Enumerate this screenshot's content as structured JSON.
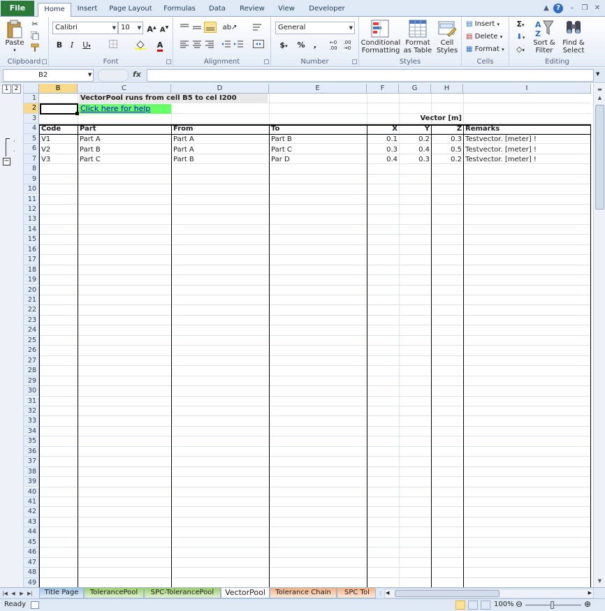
{
  "ribbon": {
    "file_tab": "File",
    "tabs": [
      "Home",
      "Insert",
      "Page Layout",
      "Formulas",
      "Data",
      "Review",
      "View",
      "Developer"
    ],
    "groups": {
      "clipboard": {
        "label": "Clipboard",
        "paste": "Paste"
      },
      "font": {
        "label": "Font",
        "font_name": "Calibri",
        "font_size": "10"
      },
      "alignment": {
        "label": "Alignment"
      },
      "number": {
        "label": "Number",
        "format": "General"
      },
      "styles": {
        "label": "Styles",
        "conditional": "Conditional Formatting",
        "format_table": "Format as Table",
        "cell_styles": "Cell Styles"
      },
      "cells": {
        "label": "Cells",
        "insert": "Insert",
        "delete": "Delete",
        "format": "Format"
      },
      "editing": {
        "label": "Editing",
        "sort": "Sort & Filter",
        "find": "Find & Select"
      }
    }
  },
  "formula_bar": {
    "name_box": "B2",
    "fx": "fx",
    "formula": ""
  },
  "grid": {
    "columns": [
      "B",
      "C",
      "D",
      "E",
      "F",
      "G",
      "H",
      "I"
    ],
    "selected_column": "B",
    "selected_row": 2,
    "row_count": 49,
    "title_text": "VectorPool runs from cell B5 to cel I200",
    "help_link": "Click here for help",
    "vector_group": "Vector [m]",
    "headers": [
      "Code",
      "Part",
      "From",
      "To",
      "X",
      "Y",
      "Z",
      "Remarks"
    ],
    "rows": [
      {
        "code": "V1",
        "part": "Part A",
        "from": "Part A",
        "to": "Part B",
        "x": "0.1",
        "y": "0.2",
        "z": "0.3",
        "remarks": "Testvector. [meter] !"
      },
      {
        "code": "V2",
        "part": "Part B",
        "from": "Part A",
        "to": "Part C",
        "x": "0.3",
        "y": "0.4",
        "z": "0.5",
        "remarks": "Testvector. [meter] !"
      },
      {
        "code": "V3",
        "part": "Part C",
        "from": "Part B",
        "to": "Par D",
        "x": "0.4",
        "y": "0.3",
        "z": "0.2",
        "remarks": "Testvector. [meter] !"
      }
    ]
  },
  "outline_levels": [
    "1",
    "2"
  ],
  "sheet_tabs": [
    {
      "label": "Title Page",
      "color": "#9fc3e7"
    },
    {
      "label": "TolerancePool",
      "color": "#9ccf6a"
    },
    {
      "label": "SPC-TolerancePool",
      "color": "#9ccf6a"
    },
    {
      "label": "VectorPool",
      "color": "#ffffff"
    },
    {
      "label": "Tolerance Chain",
      "color": "#f4b183"
    },
    {
      "label": "SPC Tol",
      "color": "#f4b183"
    }
  ],
  "active_sheet": "VectorPool",
  "status": {
    "ready": "Ready",
    "zoom": "100%"
  },
  "colors": {
    "help_bg": "#66ff66",
    "selected_header": "#f9d98a",
    "file_tab": "#2a7a3a"
  }
}
